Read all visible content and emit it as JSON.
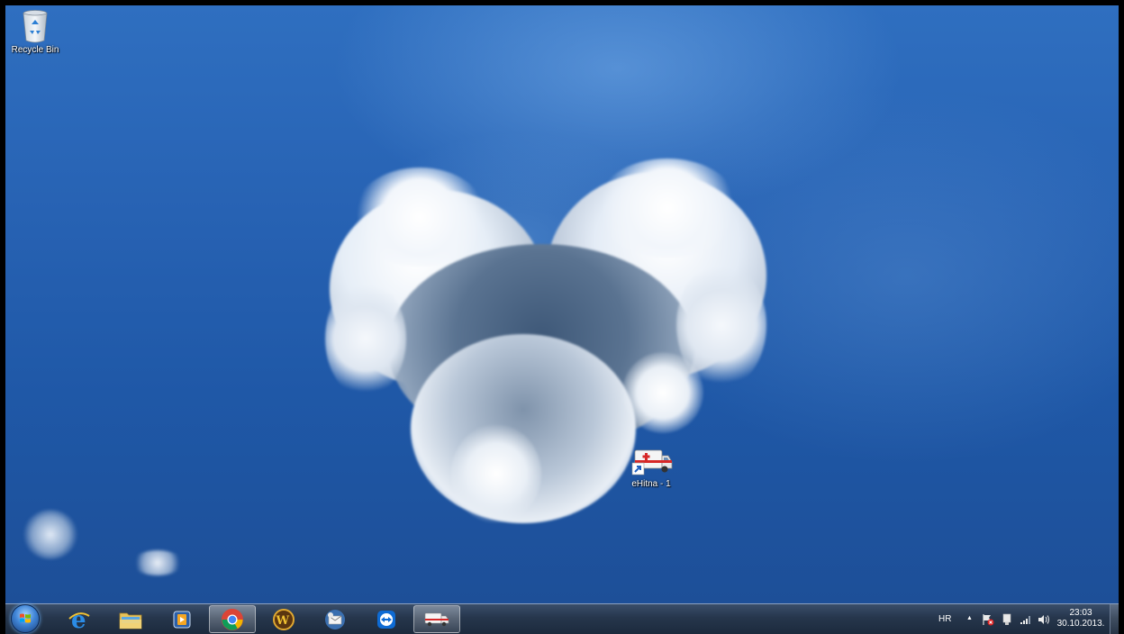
{
  "desktop": {
    "icons": [
      {
        "label": "Recycle Bin",
        "icon": "recycle-bin-icon"
      },
      {
        "label": "eHitna - 1",
        "icon": "ambulance-shortcut-icon"
      }
    ]
  },
  "taskbar": {
    "start_button": "windows-start-orb",
    "pinned": [
      {
        "name": "internet-explorer",
        "icon": "internet-explorer-icon"
      },
      {
        "name": "windows-explorer",
        "icon": "folder-icon"
      },
      {
        "name": "media-player",
        "icon": "media-player-icon"
      },
      {
        "name": "google-chrome",
        "icon": "chrome-icon",
        "active": true
      },
      {
        "name": "world-of-warcraft",
        "icon": "wow-icon"
      },
      {
        "name": "mail-client",
        "icon": "mail-client-icon"
      },
      {
        "name": "teamviewer",
        "icon": "teamviewer-icon"
      },
      {
        "name": "ehitna",
        "icon": "ambulance-icon",
        "active": true
      }
    ],
    "tray": {
      "language": "HR",
      "show_hidden": "▲",
      "clock_time": "23:03",
      "clock_date": "30.10.2013."
    }
  },
  "colors": {
    "sky": "#2762b3",
    "taskbar": "#26364c"
  }
}
